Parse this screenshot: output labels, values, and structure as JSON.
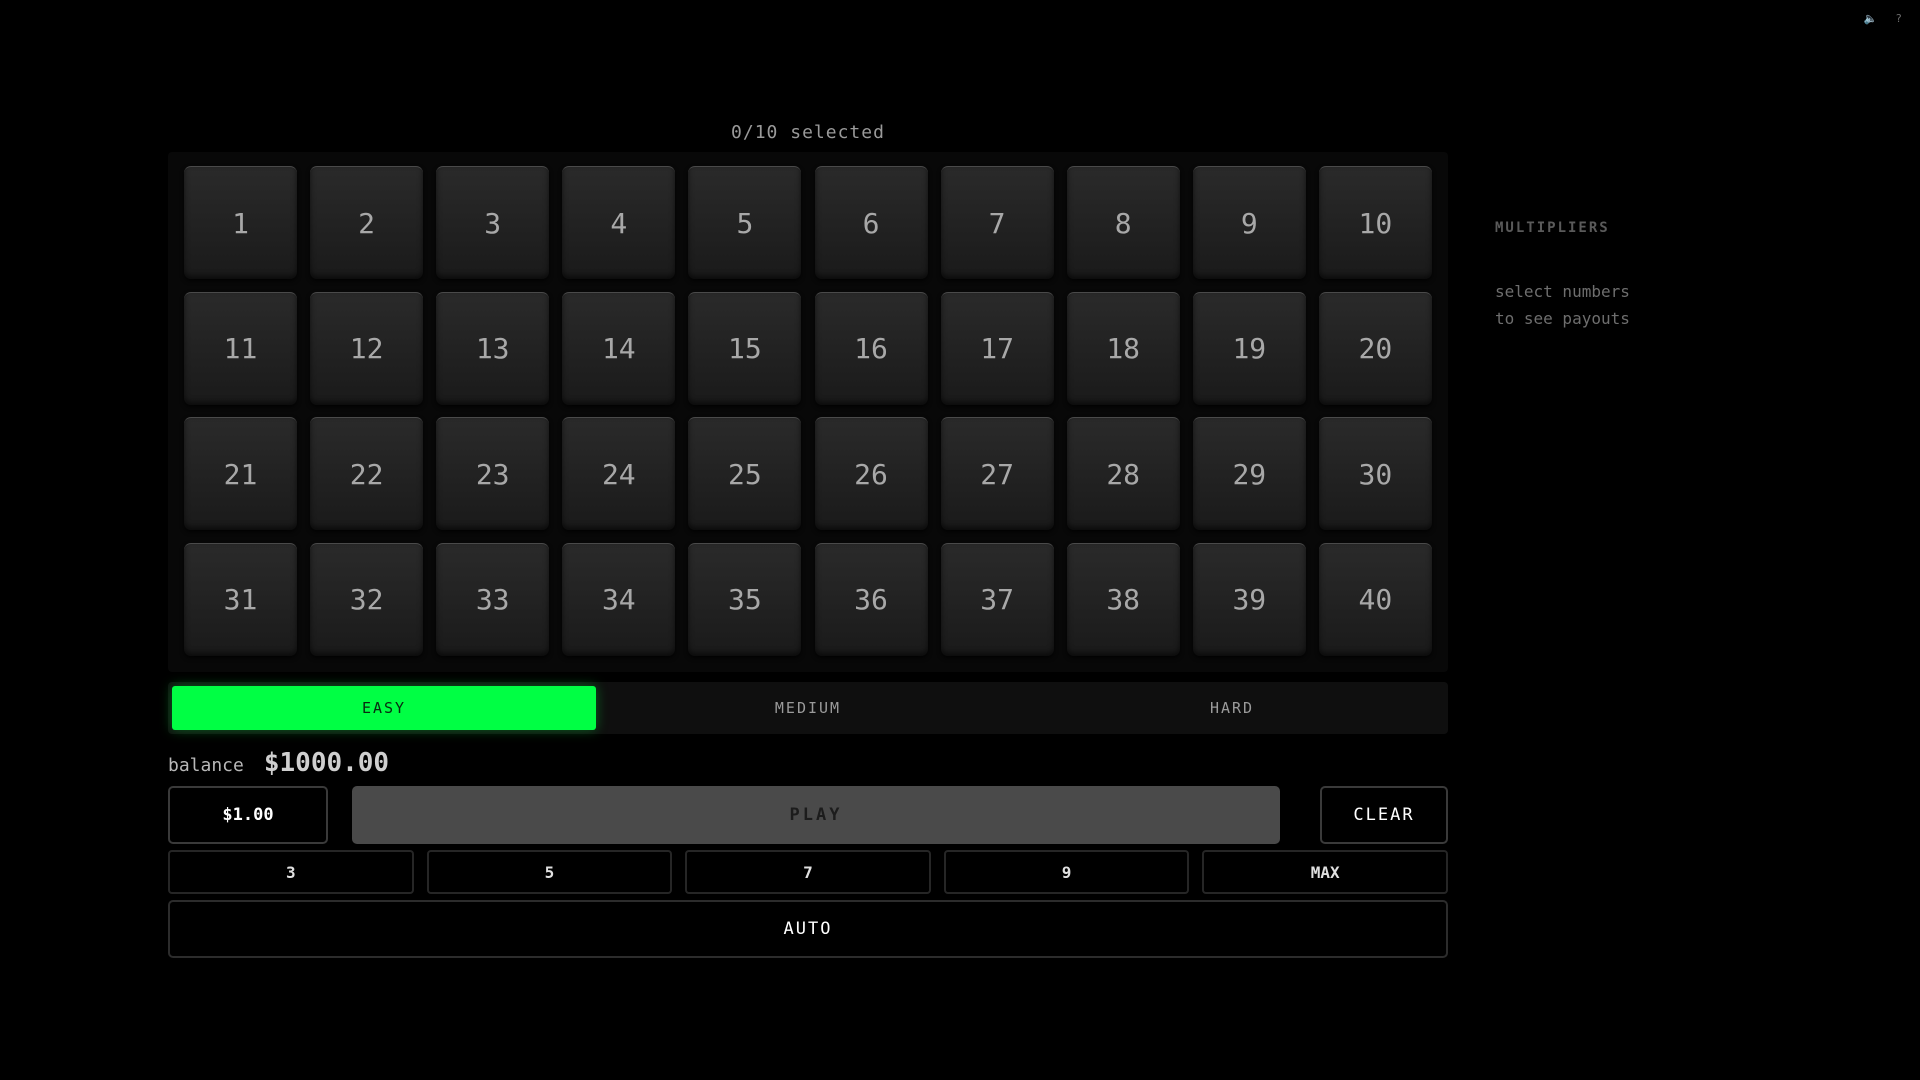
{
  "top_icons": {
    "sound": "🔈",
    "help": "?"
  },
  "selection": {
    "text": "0/10 selected"
  },
  "board": {
    "numbers": [
      "1",
      "2",
      "3",
      "4",
      "5",
      "6",
      "7",
      "8",
      "9",
      "10",
      "11",
      "12",
      "13",
      "14",
      "15",
      "16",
      "17",
      "18",
      "19",
      "20",
      "21",
      "22",
      "23",
      "24",
      "25",
      "26",
      "27",
      "28",
      "29",
      "30",
      "31",
      "32",
      "33",
      "34",
      "35",
      "36",
      "37",
      "38",
      "39",
      "40"
    ]
  },
  "difficulty": {
    "options": [
      "EASY",
      "MEDIUM",
      "HARD"
    ],
    "selected": "EASY",
    "active_color": "#00ff44"
  },
  "balance": {
    "label": "balance",
    "value": "$1000.00"
  },
  "bet": {
    "amount": "$1.00",
    "play_label": "PLAY",
    "clear_label": "CLEAR"
  },
  "quick_picks": [
    "3",
    "5",
    "7",
    "9",
    "MAX"
  ],
  "auto": {
    "label": "AUTO"
  },
  "multipliers": {
    "title": "MULTIPLIERS",
    "hint_line1": "select numbers",
    "hint_line2": "to see payouts"
  }
}
